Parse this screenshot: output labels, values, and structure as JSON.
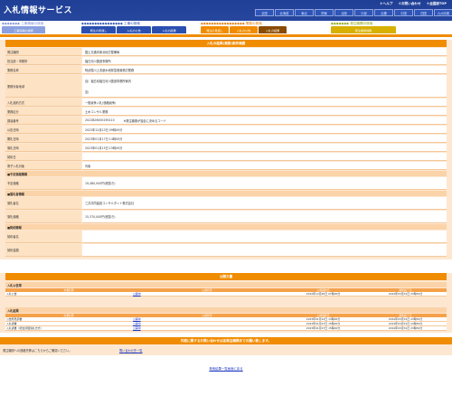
{
  "header": {
    "logo": "入札情報サービス",
    "links": [
      "＋ヘルプ",
      "＋お問い合わせ",
      "＋全国版TOP"
    ],
    "prefs": [
      "全国",
      "北海道",
      "東北",
      "関東",
      "北陸",
      "中部",
      "近畿",
      "中国",
      "四国",
      "九州沖縄"
    ]
  },
  "nav": {
    "groups": [
      {
        "label": "工事情報の検索",
        "dots": "◆◆◆◆◆◆◆",
        "tabs": [
          "工事情報の検索"
        ]
      },
      {
        "label": "工事の検索",
        "dots": "◆◆◆◆◆◆◆◆◆◆◆◆◆◆◆◆",
        "tabs": [
          "発注の見通し",
          "入札の公告",
          "入札の結果"
        ]
      },
      {
        "label": "業務の検索",
        "dots": "◆◆◆◆◆◆◆◆◆◆◆◆◆◆◆◆◆",
        "tabs": [
          "発注の見通し",
          "入札の公告",
          "入札の結果"
        ]
      },
      {
        "label": "発注機関の検索",
        "dots": "◆◆◆◆◆◆◆",
        "tabs": [
          "発注機関情報"
        ]
      }
    ]
  },
  "colors": {
    "header": "#1f3f96",
    "accent": "#f08c00",
    "panel": "#fde7d1",
    "label": "#fde2c4",
    "link": "#1a35c0"
  },
  "detail": {
    "title": "入札の結果(業務)案件概要",
    "rows": [
      {
        "label": "発注機関",
        "value": "国土交通省東北地方整備局"
      },
      {
        "label": "担当部・事務所",
        "value": "福島河川国道事務所"
      },
      {
        "label": "業務名称",
        "value": "阿武隈川上流遊水地緊急措置検討業務"
      },
      {
        "label": "業務対象地域",
        "value": "自）福島県福島河川国道事務所管内",
        "value2": "至）"
      },
      {
        "label": "入札契約方式",
        "value": "一般競争入札(価格競争)"
      },
      {
        "label": "業務区分",
        "value": "土木コンサル業務"
      },
      {
        "label": "調達番号",
        "value": "2022B26000290110",
        "memo": "※発注機関が独自に決めるコード"
      },
      {
        "label": "公告日時",
        "value": "2022年12月23日 09時00分"
      },
      {
        "label": "開札日時",
        "value": "2023年01月17日 14時00分"
      },
      {
        "label": "落札日時",
        "value": "2023年01月15日 15時00分"
      },
      {
        "label": "契約日",
        "value": ""
      },
      {
        "label": "電子入札対象",
        "value": "対象"
      }
    ],
    "price_section": "■予定価格情報",
    "price_rows": [
      {
        "label": "予定価格",
        "value": "19,480,000円(税抜き)"
      }
    ],
    "winner_section": "■落札者情報",
    "winner_rows": [
      {
        "label": "落札者名",
        "value": "三井共同建設コンサルタント株式会社"
      },
      {
        "label": "落札価格",
        "value": "15,370,000円(税抜き)"
      }
    ],
    "contract_section": "■契約情報",
    "contract_rows": [
      {
        "label": "契約者名",
        "value": ""
      },
      {
        "label": "契約金額",
        "value": ""
      }
    ]
  },
  "documents": {
    "title": "公開文書",
    "columns": [
      "文書名称",
      "公開状況",
      "公開開始日",
      "閲覧終了日"
    ],
    "notice_section": "入札公告等",
    "notice_rows": [
      {
        "name": "入札公告",
        "status": "公開中",
        "start": "2022年12月20日 07時00分",
        "end": "2024年03月31日 23時59分"
      }
    ],
    "result_section": "入札結果",
    "result_rows": [
      {
        "name": "公告所見調書",
        "status": "公開中",
        "start": "2023年01月12日 13時00分",
        "end": "2024年03月31日 23時59分"
      },
      {
        "name": "入札調書",
        "status": "公開中",
        "start": "2023年01月27日 15時00分",
        "end": "2024年03月31日 23時59分"
      },
      {
        "name": "入札調書（総合評価落札方式）",
        "status": "公開中",
        "start": "2023年01月27日 15時00分",
        "end": "2024年03月31日 23時59分"
      }
    ]
  },
  "footer": {
    "notice": "内容に関するお問い合わせは各発注機関までお願い致します。",
    "contact_text": "発注機関への連絡先等はこちらからご確認ください。",
    "contact_link": "問い合わせ先一覧",
    "back_link": "検索結果一覧画面に戻る"
  }
}
